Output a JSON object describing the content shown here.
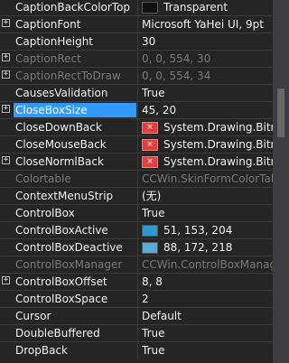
{
  "rows": [
    {
      "name": "CaptionBackColorTop",
      "value": "Transparent",
      "expander": "",
      "swatch": "#101010",
      "icon": "",
      "state": "normal"
    },
    {
      "name": "CaptionFont",
      "value": "Microsoft YaHei UI, 9pt",
      "expander": "+",
      "swatch": "",
      "icon": "",
      "state": "normal"
    },
    {
      "name": "CaptionHeight",
      "value": "30",
      "expander": "",
      "swatch": "",
      "icon": "",
      "state": "normal"
    },
    {
      "name": "CaptionRect",
      "value": "0, 0, 554, 30",
      "expander": "+",
      "swatch": "",
      "icon": "",
      "state": "disabled"
    },
    {
      "name": "CaptionRectToDraw",
      "value": "0, 0, 554, 34",
      "expander": "+",
      "swatch": "",
      "icon": "",
      "state": "disabled"
    },
    {
      "name": "CausesValidation",
      "value": "True",
      "expander": "",
      "swatch": "",
      "icon": "",
      "state": "normal"
    },
    {
      "name": "CloseBoxSize",
      "value": "45, 20",
      "expander": "+",
      "swatch": "",
      "icon": "",
      "state": "selected"
    },
    {
      "name": "CloseDownBack",
      "value": "System.Drawing.Bitm",
      "expander": "",
      "swatch": "",
      "icon": "image",
      "state": "normal"
    },
    {
      "name": "CloseMouseBack",
      "value": "System.Drawing.Bitm",
      "expander": "",
      "swatch": "",
      "icon": "image",
      "state": "normal"
    },
    {
      "name": "CloseNormlBack",
      "value": "System.Drawing.Bitm",
      "expander": "+",
      "swatch": "",
      "icon": "image",
      "state": "normal"
    },
    {
      "name": "Colortable",
      "value": "CCWin.SkinFormColorTal",
      "expander": "",
      "swatch": "",
      "icon": "",
      "state": "disabled"
    },
    {
      "name": "ContextMenuStrip",
      "value": "(无)",
      "expander": "",
      "swatch": "",
      "icon": "",
      "state": "normal"
    },
    {
      "name": "ControlBox",
      "value": "True",
      "expander": "",
      "swatch": "",
      "icon": "",
      "state": "normal"
    },
    {
      "name": "ControlBoxActive",
      "value": "51, 153, 204",
      "expander": "",
      "swatch": "#3399cc",
      "icon": "",
      "state": "normal"
    },
    {
      "name": "ControlBoxDeactive",
      "value": "88, 172, 218",
      "expander": "",
      "swatch": "#58acda",
      "icon": "",
      "state": "normal"
    },
    {
      "name": "ControlBoxManager",
      "value": "CCWin.ControlBoxManag",
      "expander": "",
      "swatch": "",
      "icon": "",
      "state": "disabled"
    },
    {
      "name": "ControlBoxOffset",
      "value": "8, 8",
      "expander": "+",
      "swatch": "",
      "icon": "",
      "state": "normal"
    },
    {
      "name": "ControlBoxSpace",
      "value": "2",
      "expander": "",
      "swatch": "",
      "icon": "",
      "state": "normal"
    },
    {
      "name": "Cursor",
      "value": "Default",
      "expander": "",
      "swatch": "",
      "icon": "",
      "state": "normal"
    },
    {
      "name": "DoubleBuffered",
      "value": "True",
      "expander": "",
      "swatch": "",
      "icon": "",
      "state": "normal"
    },
    {
      "name": "DropBack",
      "value": "True",
      "expander": "",
      "swatch": "",
      "icon": "",
      "state": "normal"
    }
  ],
  "icon_names": {
    "expander": "expand-plus-icon",
    "image": "image-thumbnail-icon"
  },
  "colors": {
    "selection": "#3399ff",
    "background": "#252526",
    "disabled_text": "#7a7a7a"
  }
}
